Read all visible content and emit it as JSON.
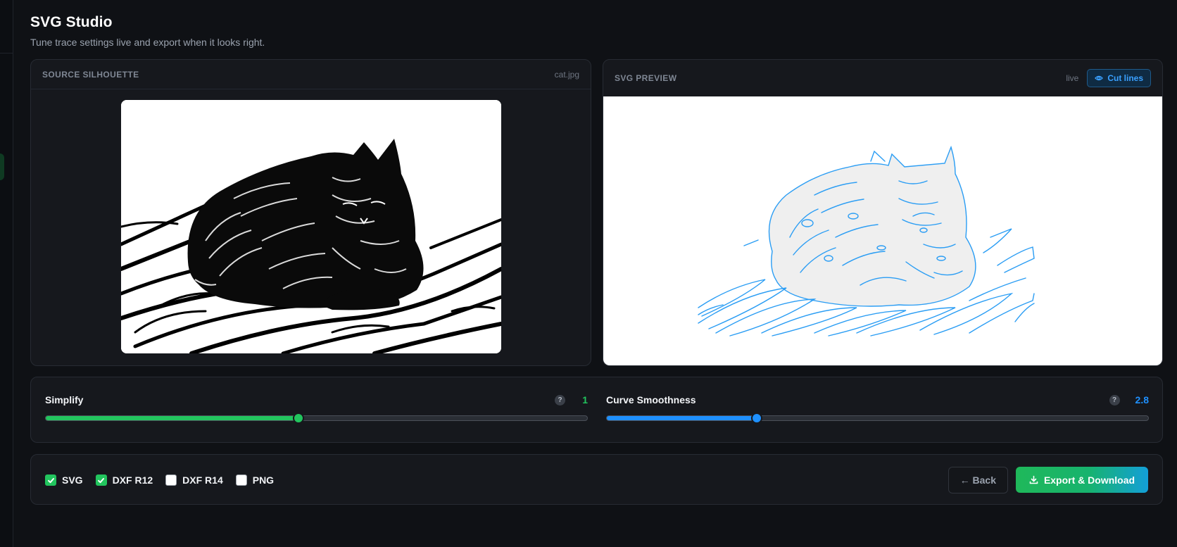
{
  "header": {
    "title": "SVG Studio",
    "subtitle": "Tune trace settings live and export when it looks right."
  },
  "source": {
    "title": "SOURCE SILHOUETTE",
    "filename": "cat.jpg"
  },
  "preview": {
    "title": "SVG PREVIEW",
    "status": "live",
    "cut_lines_label": "Cut lines",
    "cut_lines_icon": "eye-icon",
    "line_color": "#2a9df4"
  },
  "sliders": {
    "simplify": {
      "label": "Simplify",
      "value": "1",
      "fraction": 0.467,
      "color": "#22c55e"
    },
    "smoothness": {
      "label": "Curve Smoothness",
      "value": "2.8",
      "fraction": 0.277,
      "color": "#1e90ff"
    },
    "help_glyph": "?"
  },
  "formats": [
    {
      "label": "SVG",
      "checked": true
    },
    {
      "label": "DXF R12",
      "checked": true
    },
    {
      "label": "DXF R14",
      "checked": false
    },
    {
      "label": "PNG",
      "checked": false
    }
  ],
  "actions": {
    "back_label": "← Back",
    "export_label": "Export & Download",
    "export_icon": "download-icon"
  }
}
